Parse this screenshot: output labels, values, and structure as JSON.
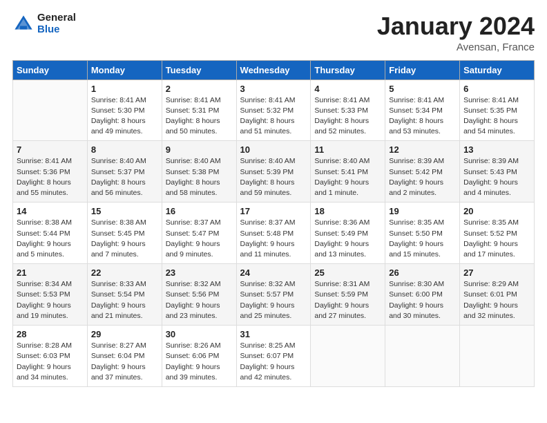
{
  "header": {
    "logo_general": "General",
    "logo_blue": "Blue",
    "title": "January 2024",
    "location": "Avensan, France"
  },
  "columns": [
    "Sunday",
    "Monday",
    "Tuesday",
    "Wednesday",
    "Thursday",
    "Friday",
    "Saturday"
  ],
  "weeks": [
    [
      {
        "day": "",
        "info": ""
      },
      {
        "day": "1",
        "info": "Sunrise: 8:41 AM\nSunset: 5:30 PM\nDaylight: 8 hours\nand 49 minutes."
      },
      {
        "day": "2",
        "info": "Sunrise: 8:41 AM\nSunset: 5:31 PM\nDaylight: 8 hours\nand 50 minutes."
      },
      {
        "day": "3",
        "info": "Sunrise: 8:41 AM\nSunset: 5:32 PM\nDaylight: 8 hours\nand 51 minutes."
      },
      {
        "day": "4",
        "info": "Sunrise: 8:41 AM\nSunset: 5:33 PM\nDaylight: 8 hours\nand 52 minutes."
      },
      {
        "day": "5",
        "info": "Sunrise: 8:41 AM\nSunset: 5:34 PM\nDaylight: 8 hours\nand 53 minutes."
      },
      {
        "day": "6",
        "info": "Sunrise: 8:41 AM\nSunset: 5:35 PM\nDaylight: 8 hours\nand 54 minutes."
      }
    ],
    [
      {
        "day": "7",
        "info": "Sunrise: 8:41 AM\nSunset: 5:36 PM\nDaylight: 8 hours\nand 55 minutes."
      },
      {
        "day": "8",
        "info": "Sunrise: 8:40 AM\nSunset: 5:37 PM\nDaylight: 8 hours\nand 56 minutes."
      },
      {
        "day": "9",
        "info": "Sunrise: 8:40 AM\nSunset: 5:38 PM\nDaylight: 8 hours\nand 58 minutes."
      },
      {
        "day": "10",
        "info": "Sunrise: 8:40 AM\nSunset: 5:39 PM\nDaylight: 8 hours\nand 59 minutes."
      },
      {
        "day": "11",
        "info": "Sunrise: 8:40 AM\nSunset: 5:41 PM\nDaylight: 9 hours\nand 1 minute."
      },
      {
        "day": "12",
        "info": "Sunrise: 8:39 AM\nSunset: 5:42 PM\nDaylight: 9 hours\nand 2 minutes."
      },
      {
        "day": "13",
        "info": "Sunrise: 8:39 AM\nSunset: 5:43 PM\nDaylight: 9 hours\nand 4 minutes."
      }
    ],
    [
      {
        "day": "14",
        "info": "Sunrise: 8:38 AM\nSunset: 5:44 PM\nDaylight: 9 hours\nand 5 minutes."
      },
      {
        "day": "15",
        "info": "Sunrise: 8:38 AM\nSunset: 5:45 PM\nDaylight: 9 hours\nand 7 minutes."
      },
      {
        "day": "16",
        "info": "Sunrise: 8:37 AM\nSunset: 5:47 PM\nDaylight: 9 hours\nand 9 minutes."
      },
      {
        "day": "17",
        "info": "Sunrise: 8:37 AM\nSunset: 5:48 PM\nDaylight: 9 hours\nand 11 minutes."
      },
      {
        "day": "18",
        "info": "Sunrise: 8:36 AM\nSunset: 5:49 PM\nDaylight: 9 hours\nand 13 minutes."
      },
      {
        "day": "19",
        "info": "Sunrise: 8:35 AM\nSunset: 5:50 PM\nDaylight: 9 hours\nand 15 minutes."
      },
      {
        "day": "20",
        "info": "Sunrise: 8:35 AM\nSunset: 5:52 PM\nDaylight: 9 hours\nand 17 minutes."
      }
    ],
    [
      {
        "day": "21",
        "info": "Sunrise: 8:34 AM\nSunset: 5:53 PM\nDaylight: 9 hours\nand 19 minutes."
      },
      {
        "day": "22",
        "info": "Sunrise: 8:33 AM\nSunset: 5:54 PM\nDaylight: 9 hours\nand 21 minutes."
      },
      {
        "day": "23",
        "info": "Sunrise: 8:32 AM\nSunset: 5:56 PM\nDaylight: 9 hours\nand 23 minutes."
      },
      {
        "day": "24",
        "info": "Sunrise: 8:32 AM\nSunset: 5:57 PM\nDaylight: 9 hours\nand 25 minutes."
      },
      {
        "day": "25",
        "info": "Sunrise: 8:31 AM\nSunset: 5:59 PM\nDaylight: 9 hours\nand 27 minutes."
      },
      {
        "day": "26",
        "info": "Sunrise: 8:30 AM\nSunset: 6:00 PM\nDaylight: 9 hours\nand 30 minutes."
      },
      {
        "day": "27",
        "info": "Sunrise: 8:29 AM\nSunset: 6:01 PM\nDaylight: 9 hours\nand 32 minutes."
      }
    ],
    [
      {
        "day": "28",
        "info": "Sunrise: 8:28 AM\nSunset: 6:03 PM\nDaylight: 9 hours\nand 34 minutes."
      },
      {
        "day": "29",
        "info": "Sunrise: 8:27 AM\nSunset: 6:04 PM\nDaylight: 9 hours\nand 37 minutes."
      },
      {
        "day": "30",
        "info": "Sunrise: 8:26 AM\nSunset: 6:06 PM\nDaylight: 9 hours\nand 39 minutes."
      },
      {
        "day": "31",
        "info": "Sunrise: 8:25 AM\nSunset: 6:07 PM\nDaylight: 9 hours\nand 42 minutes."
      },
      {
        "day": "",
        "info": ""
      },
      {
        "day": "",
        "info": ""
      },
      {
        "day": "",
        "info": ""
      }
    ]
  ]
}
